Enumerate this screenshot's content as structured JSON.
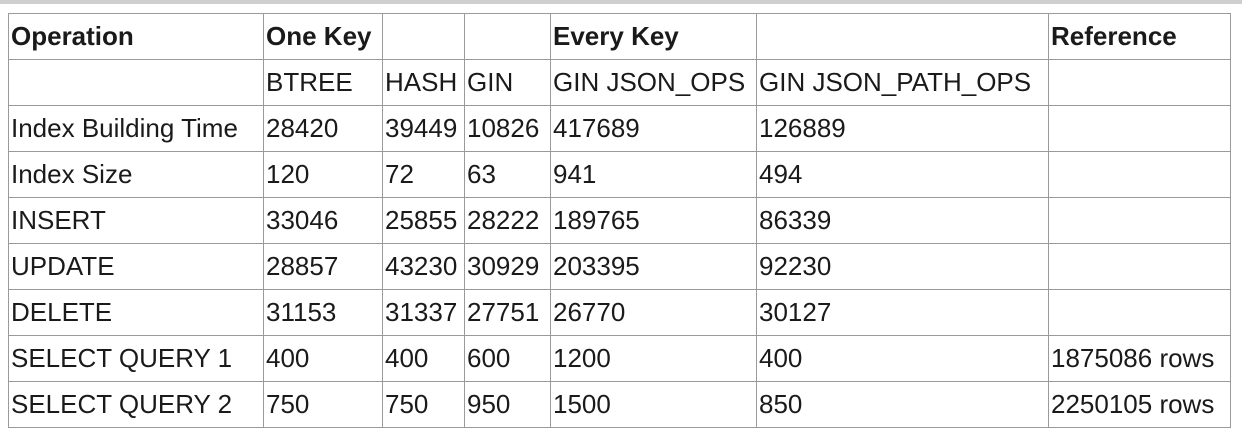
{
  "table": {
    "header_top": [
      "Operation",
      "One Key",
      "",
      "",
      "Every Key",
      "",
      "Reference"
    ],
    "header_sub": [
      "",
      "BTREE",
      "HASH",
      "GIN",
      "GIN JSON_OPS",
      "GIN JSON_PATH_OPS",
      ""
    ],
    "rows": [
      [
        "Index Building Time",
        "28420",
        "39449",
        "10826",
        "417689",
        "126889",
        ""
      ],
      [
        "Index Size",
        "120",
        "72",
        "63",
        "941",
        "494",
        ""
      ],
      [
        "INSERT",
        "33046",
        "25855",
        "28222",
        "189765",
        "86339",
        ""
      ],
      [
        "UPDATE",
        "28857",
        "43230",
        "30929",
        "203395",
        "92230",
        ""
      ],
      [
        "DELETE",
        "31153",
        "31337",
        "27751",
        "26770",
        "30127",
        ""
      ],
      [
        "SELECT QUERY 1",
        "400",
        "400",
        "600",
        "1200",
        "400",
        "1875086 rows"
      ],
      [
        "SELECT QUERY 2",
        "750",
        "750",
        "950",
        "1500",
        "850",
        "2250105 rows"
      ]
    ]
  }
}
